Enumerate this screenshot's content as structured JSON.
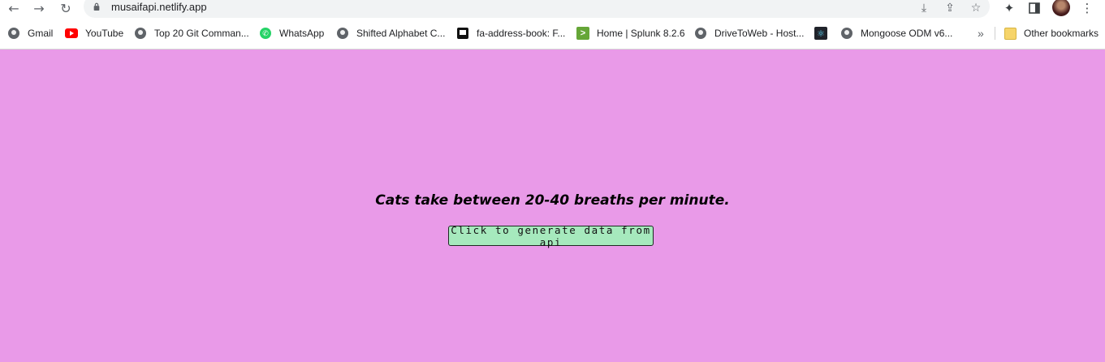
{
  "browser": {
    "url": "musaifapi.netlify.app",
    "nav": {
      "back": "←",
      "forward": "→",
      "reload": "↻"
    },
    "toolbar_icons": [
      "download-icon",
      "share-icon",
      "star-icon",
      "extensions-icon",
      "side-panel-icon",
      "menu-icon"
    ],
    "bookmarks": [
      {
        "label": "Gmail",
        "icon": "globe-icon"
      },
      {
        "label": "YouTube",
        "icon": "youtube-icon"
      },
      {
        "label": "Top 20 Git Comman...",
        "icon": "globe-icon"
      },
      {
        "label": "WhatsApp",
        "icon": "whatsapp-icon"
      },
      {
        "label": "Shifted Alphabet C...",
        "icon": "globe-icon"
      },
      {
        "label": "fa-address-book: F...",
        "icon": "flag-icon"
      },
      {
        "label": "Home | Splunk 8.2.6",
        "icon": "splunk-icon"
      },
      {
        "label": "DriveToWeb - Host...",
        "icon": "globe-icon"
      },
      {
        "label": "",
        "icon": "react-icon"
      },
      {
        "label": "Mongoose ODM v6...",
        "icon": "globe-icon"
      }
    ],
    "overflow": "»",
    "other_bookmarks": "Other bookmarks"
  },
  "page": {
    "background": "#e99ae8",
    "fact_text": "Cats take between 20-40 breaths per minute.",
    "button_label": "Click to generate data from api",
    "button_color": "#a6e9bd"
  }
}
